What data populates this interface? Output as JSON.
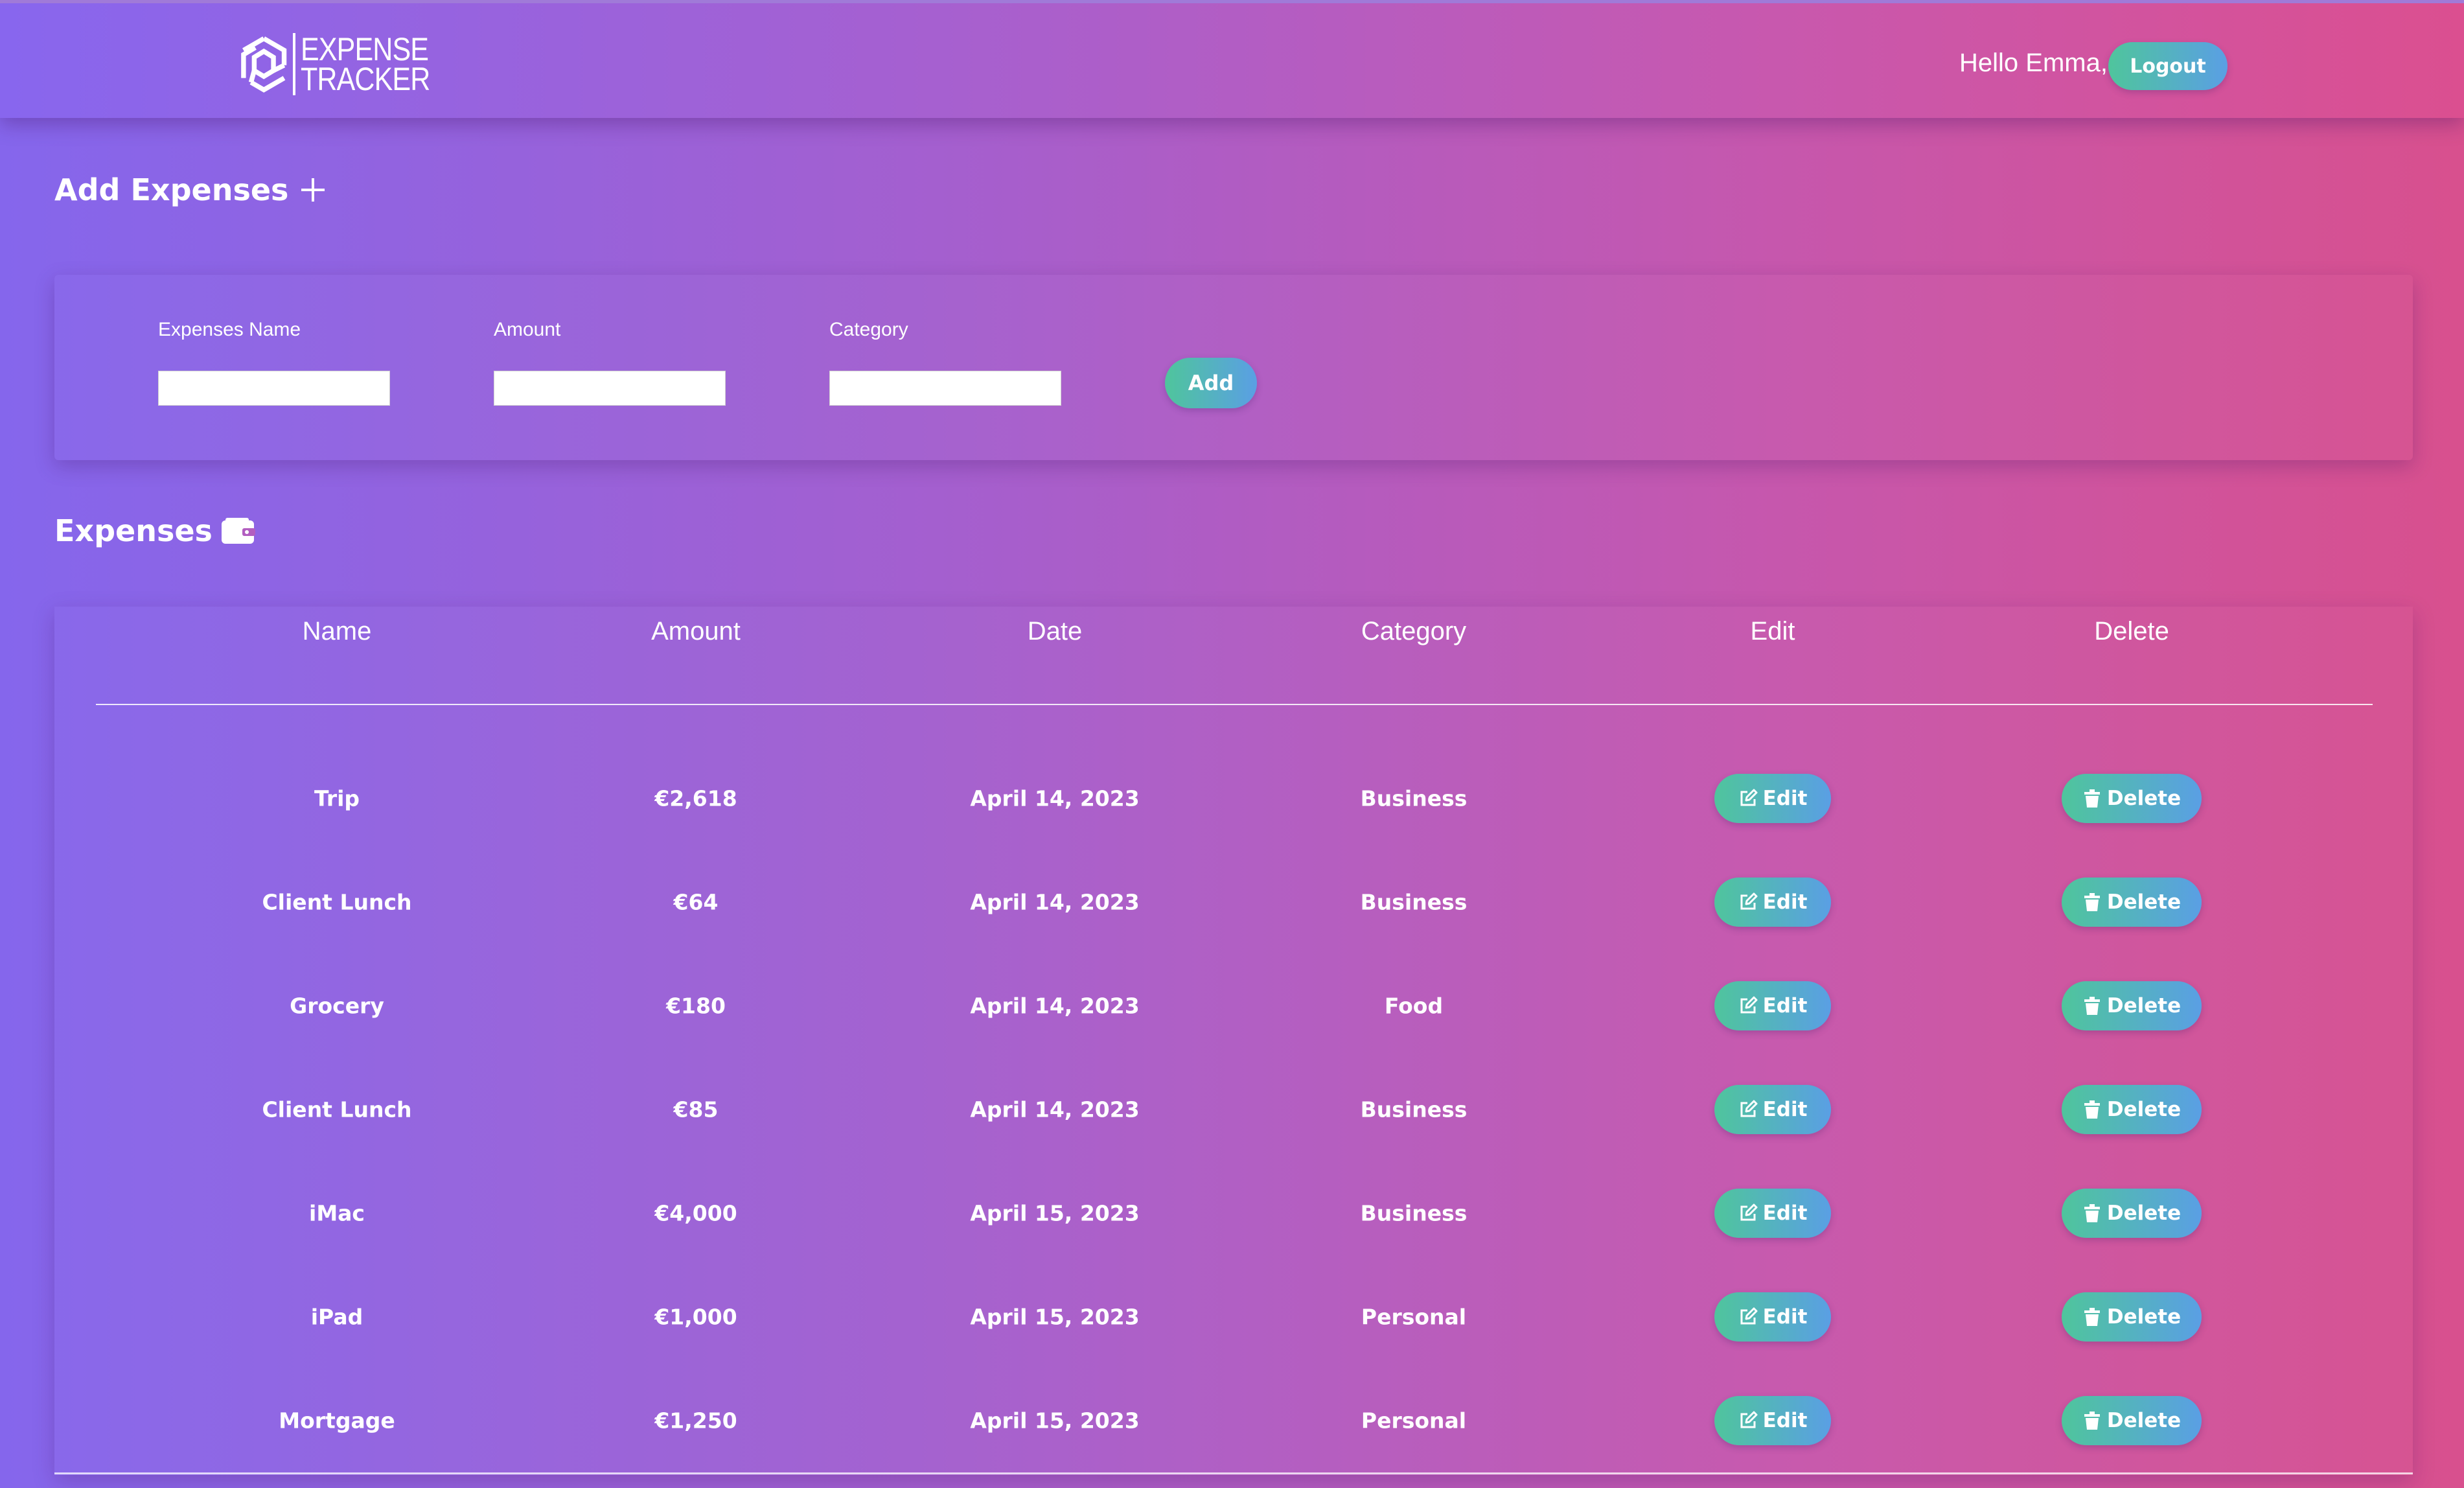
{
  "header": {
    "logo_line1": "EXPENSE",
    "logo_line2": "TRACKER",
    "greeting": "Hello Emma,",
    "logout_label": "Logout"
  },
  "add_section": {
    "title": "Add Expenses",
    "name_label": "Expenses Name",
    "name_value": "",
    "amount_label": "Amount",
    "amount_value": "",
    "category_label": "Category",
    "category_value": "",
    "add_label": "Add"
  },
  "expenses_section": {
    "title": "Expenses",
    "columns": [
      "Name",
      "Amount",
      "Date",
      "Category",
      "Edit",
      "Delete"
    ],
    "rows": [
      {
        "name": "Trip",
        "amount": "€2,618",
        "date": "April 14, 2023",
        "category": "Business"
      },
      {
        "name": "Client Lunch",
        "amount": "€64",
        "date": "April 14, 2023",
        "category": "Business"
      },
      {
        "name": "Grocery",
        "amount": "€180",
        "date": "April 14, 2023",
        "category": "Food"
      },
      {
        "name": "Client Lunch",
        "amount": "€85",
        "date": "April 14, 2023",
        "category": "Business"
      },
      {
        "name": "iMac",
        "amount": "€4,000",
        "date": "April 15, 2023",
        "category": "Business"
      },
      {
        "name": "iPad",
        "amount": "€1,000",
        "date": "April 15, 2023",
        "category": "Personal"
      },
      {
        "name": "Mortgage",
        "amount": "€1,250",
        "date": "April 15, 2023",
        "category": "Personal"
      }
    ],
    "edit_label": "Edit",
    "delete_label": "Delete"
  },
  "icons": {
    "logo": "hexagon-logo-icon",
    "add": "plus-icon",
    "expenses": "wallet-icon",
    "edit": "pencil-square-icon",
    "delete": "trash-icon"
  },
  "colors": {
    "gradient_start": "#8566ec",
    "gradient_mid": "#a45fcf",
    "gradient_end": "#d8508e",
    "button_start": "#4fc59c",
    "button_end": "#5a9fe4"
  }
}
